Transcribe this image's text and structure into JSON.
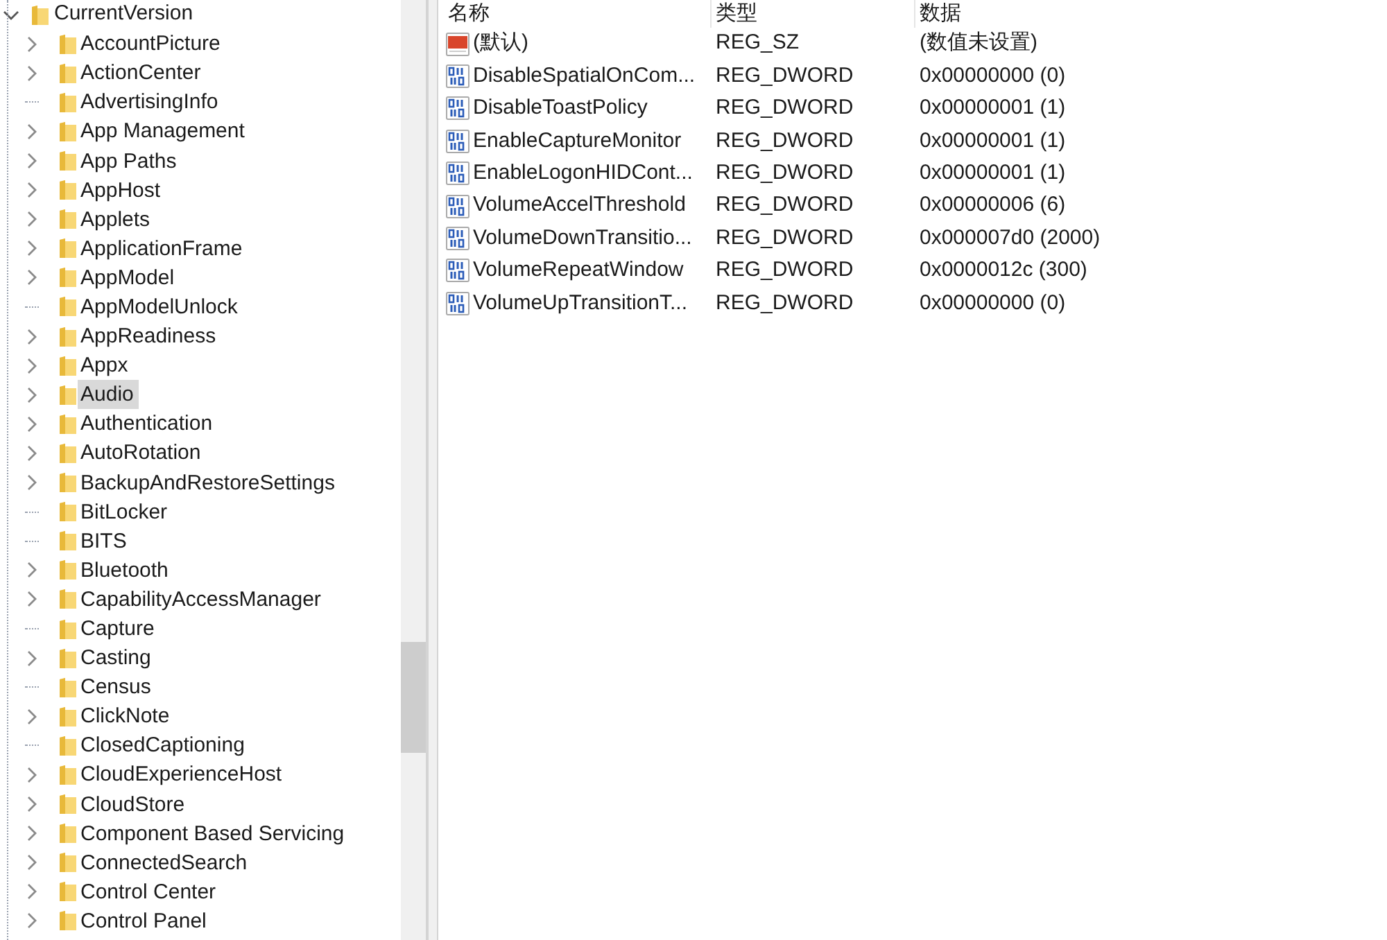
{
  "tree": {
    "root": {
      "label": "CurrentVersion",
      "expanded": true
    },
    "children": [
      {
        "label": "AccountPicture",
        "expandable": true,
        "selected": false
      },
      {
        "label": "ActionCenter",
        "expandable": true,
        "selected": false
      },
      {
        "label": "AdvertisingInfo",
        "expandable": false,
        "selected": false
      },
      {
        "label": "App Management",
        "expandable": true,
        "selected": false
      },
      {
        "label": "App Paths",
        "expandable": true,
        "selected": false
      },
      {
        "label": "AppHost",
        "expandable": true,
        "selected": false
      },
      {
        "label": "Applets",
        "expandable": true,
        "selected": false
      },
      {
        "label": "ApplicationFrame",
        "expandable": true,
        "selected": false
      },
      {
        "label": "AppModel",
        "expandable": true,
        "selected": false
      },
      {
        "label": "AppModelUnlock",
        "expandable": false,
        "selected": false
      },
      {
        "label": "AppReadiness",
        "expandable": true,
        "selected": false
      },
      {
        "label": "Appx",
        "expandable": true,
        "selected": false
      },
      {
        "label": "Audio",
        "expandable": true,
        "selected": true
      },
      {
        "label": "Authentication",
        "expandable": true,
        "selected": false
      },
      {
        "label": "AutoRotation",
        "expandable": true,
        "selected": false
      },
      {
        "label": "BackupAndRestoreSettings",
        "expandable": true,
        "selected": false
      },
      {
        "label": "BitLocker",
        "expandable": false,
        "selected": false
      },
      {
        "label": "BITS",
        "expandable": false,
        "selected": false
      },
      {
        "label": "Bluetooth",
        "expandable": true,
        "selected": false
      },
      {
        "label": "CapabilityAccessManager",
        "expandable": true,
        "selected": false
      },
      {
        "label": "Capture",
        "expandable": false,
        "selected": false
      },
      {
        "label": "Casting",
        "expandable": true,
        "selected": false
      },
      {
        "label": "Census",
        "expandable": false,
        "selected": false
      },
      {
        "label": "ClickNote",
        "expandable": true,
        "selected": false
      },
      {
        "label": "ClosedCaptioning",
        "expandable": false,
        "selected": false
      },
      {
        "label": "CloudExperienceHost",
        "expandable": true,
        "selected": false
      },
      {
        "label": "CloudStore",
        "expandable": true,
        "selected": false
      },
      {
        "label": "Component Based Servicing",
        "expandable": true,
        "selected": false
      },
      {
        "label": "ConnectedSearch",
        "expandable": true,
        "selected": false
      },
      {
        "label": "Control Center",
        "expandable": true,
        "selected": false
      },
      {
        "label": "Control Panel",
        "expandable": true,
        "selected": false
      }
    ]
  },
  "table": {
    "columns": [
      "名称",
      "类型",
      "数据"
    ],
    "rows": [
      {
        "kind": "string",
        "name": "(默认)",
        "type": "REG_SZ",
        "data": "(数值未设置)"
      },
      {
        "kind": "dword",
        "name": "DisableSpatialOnCom...",
        "type": "REG_DWORD",
        "data": "0x00000000 (0)"
      },
      {
        "kind": "dword",
        "name": "DisableToastPolicy",
        "type": "REG_DWORD",
        "data": "0x00000001 (1)"
      },
      {
        "kind": "dword",
        "name": "EnableCaptureMonitor",
        "type": "REG_DWORD",
        "data": "0x00000001 (1)"
      },
      {
        "kind": "dword",
        "name": "EnableLogonHIDCont...",
        "type": "REG_DWORD",
        "data": "0x00000001 (1)"
      },
      {
        "kind": "dword",
        "name": "VolumeAccelThreshold",
        "type": "REG_DWORD",
        "data": "0x00000006 (6)"
      },
      {
        "kind": "dword",
        "name": "VolumeDownTransitio...",
        "type": "REG_DWORD",
        "data": "0x000007d0 (2000)"
      },
      {
        "kind": "dword",
        "name": "VolumeRepeatWindow",
        "type": "REG_DWORD",
        "data": "0x0000012c (300)"
      },
      {
        "kind": "dword",
        "name": "VolumeUpTransitionT...",
        "type": "REG_DWORD",
        "data": "0x00000000 (0)"
      }
    ]
  }
}
